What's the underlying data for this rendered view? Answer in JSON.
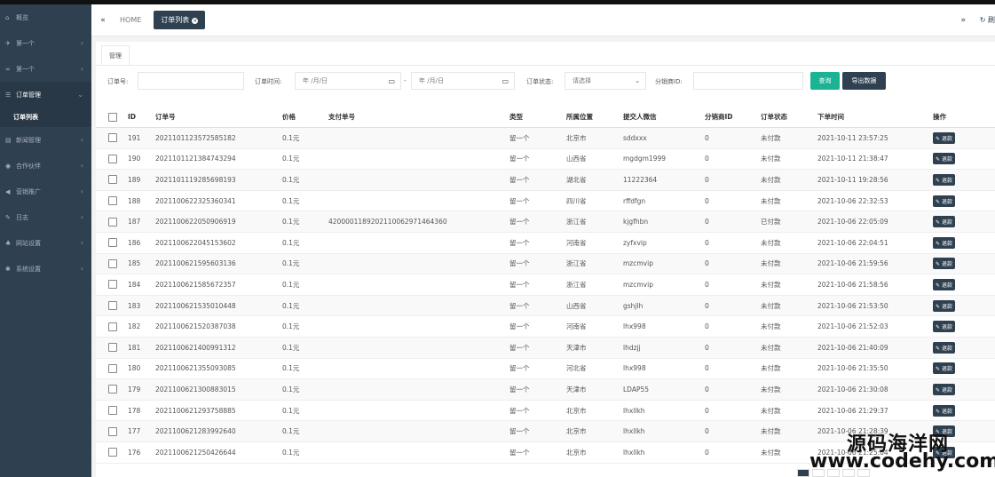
{
  "sidebar": {
    "items": [
      {
        "icon": "home-icon",
        "glyph": "⌂",
        "label": "概览",
        "chevron": ""
      },
      {
        "icon": "send-icon",
        "glyph": "✈",
        "label": "第一个",
        "chevron": "‹"
      },
      {
        "icon": "link-icon",
        "glyph": "∞",
        "label": "第一个",
        "chevron": "‹"
      },
      {
        "icon": "list-icon",
        "glyph": "☰",
        "label": "订单管理",
        "chevron": "⌄"
      },
      {
        "icon": "news-icon",
        "glyph": "▤",
        "label": "新闻管理",
        "chevron": "‹"
      },
      {
        "icon": "eye-icon",
        "glyph": "◉",
        "label": "合作伙伴",
        "chevron": "‹"
      },
      {
        "icon": "bullhorn-icon",
        "glyph": "◀",
        "label": "营销推广",
        "chevron": "‹"
      },
      {
        "icon": "edit-icon",
        "glyph": "✎",
        "label": "日志",
        "chevron": "‹"
      },
      {
        "icon": "sitemap-icon",
        "glyph": "♣",
        "label": "网站设置",
        "chevron": "‹"
      },
      {
        "icon": "gear-icon",
        "glyph": "✱",
        "label": "系统设置",
        "chevron": "‹"
      }
    ],
    "sub_active": "订单列表"
  },
  "tabs": {
    "left_icon": "«",
    "home": "HOME",
    "active": "订单列表",
    "close": "×",
    "right_icon": "»",
    "refresh_icon": "↻",
    "refresh_label": "刷"
  },
  "subtab": "管理",
  "filters": {
    "order_no_label": "订单号:",
    "order_time_label": "订单时间:",
    "date_placeholder_1": "年 /月/日",
    "date_sep": "-",
    "date_placeholder_2": "年 /月/日",
    "status_label": "订单状态:",
    "status_value": "请选择",
    "dist_label": "分销商ID:",
    "search_btn": "查询",
    "export_btn": "导出数据"
  },
  "table": {
    "headers": [
      "ID",
      "订单号",
      "价格",
      "支付单号",
      "类型",
      "所属位置",
      "提交人微信",
      "分销商ID",
      "订单状态",
      "下单时间",
      "操作"
    ],
    "action_label": "退款",
    "rows": [
      [
        "191",
        "2021101123572585182",
        "0.1元",
        "",
        "留一个",
        "北京市",
        "sddxxx",
        "0",
        "未付款",
        "2021-10-11 23:57:25"
      ],
      [
        "190",
        "2021101121384743294",
        "0.1元",
        "",
        "留一个",
        "山西省",
        "mgdgm1999",
        "0",
        "未付款",
        "2021-10-11 21:38:47"
      ],
      [
        "189",
        "2021101119285698193",
        "0.1元",
        "",
        "留一个",
        "湖北省",
        "11222364",
        "0",
        "未付款",
        "2021-10-11 19:28:56"
      ],
      [
        "188",
        "2021100622325360341",
        "0.1元",
        "",
        "留一个",
        "四川省",
        "rffdfgn",
        "0",
        "未付款",
        "2021-10-06 22:32:53"
      ],
      [
        "187",
        "2021100622050906919",
        "0.1元",
        "4200001189202110062971464360",
        "留一个",
        "浙江省",
        "kjgfhbn",
        "0",
        "已付款",
        "2021-10-06 22:05:09"
      ],
      [
        "186",
        "2021100622045153602",
        "0.1元",
        "",
        "留一个",
        "河南省",
        "zyfxvip",
        "0",
        "未付款",
        "2021-10-06 22:04:51"
      ],
      [
        "185",
        "2021100621595603136",
        "0.1元",
        "",
        "留一个",
        "浙江省",
        "mzcmvip",
        "0",
        "未付款",
        "2021-10-06 21:59:56"
      ],
      [
        "184",
        "2021100621585672357",
        "0.1元",
        "",
        "留一个",
        "浙江省",
        "mzcmvip",
        "0",
        "未付款",
        "2021-10-06 21:58:56"
      ],
      [
        "183",
        "2021100621535010448",
        "0.1元",
        "",
        "留一个",
        "山西省",
        "gshjlh",
        "0",
        "未付款",
        "2021-10-06 21:53:50"
      ],
      [
        "182",
        "2021100621520387038",
        "0.1元",
        "",
        "留一个",
        "河南省",
        "lhx998",
        "0",
        "未付款",
        "2021-10-06 21:52:03"
      ],
      [
        "181",
        "2021100621400991312",
        "0.1元",
        "",
        "留一个",
        "天津市",
        "lhdzjj",
        "0",
        "未付款",
        "2021-10-06 21:40:09"
      ],
      [
        "180",
        "2021100621355093085",
        "0.1元",
        "",
        "留一个",
        "河北省",
        "lhx998",
        "0",
        "未付款",
        "2021-10-06 21:35:50"
      ],
      [
        "179",
        "2021100621300883015",
        "0.1元",
        "",
        "留一个",
        "天津市",
        "LDAP55",
        "0",
        "未付款",
        "2021-10-06 21:30:08"
      ],
      [
        "178",
        "2021100621293758885",
        "0.1元",
        "",
        "留一个",
        "北京市",
        "lhxllkh",
        "0",
        "未付款",
        "2021-10-06 21:29:37"
      ],
      [
        "177",
        "2021100621283992640",
        "0.1元",
        "",
        "留一个",
        "北京市",
        "lhxllkh",
        "0",
        "未付款",
        "2021-10-06 21:28:39"
      ],
      [
        "176",
        "2021100621250426644",
        "0.1元",
        "",
        "留一个",
        "北京市",
        "lhxllkh",
        "0",
        "未付款",
        "2021-10-06 21:25:04"
      ]
    ]
  },
  "watermark": {
    "line1": "源码海洋网",
    "line2": "www.codehy.com"
  }
}
